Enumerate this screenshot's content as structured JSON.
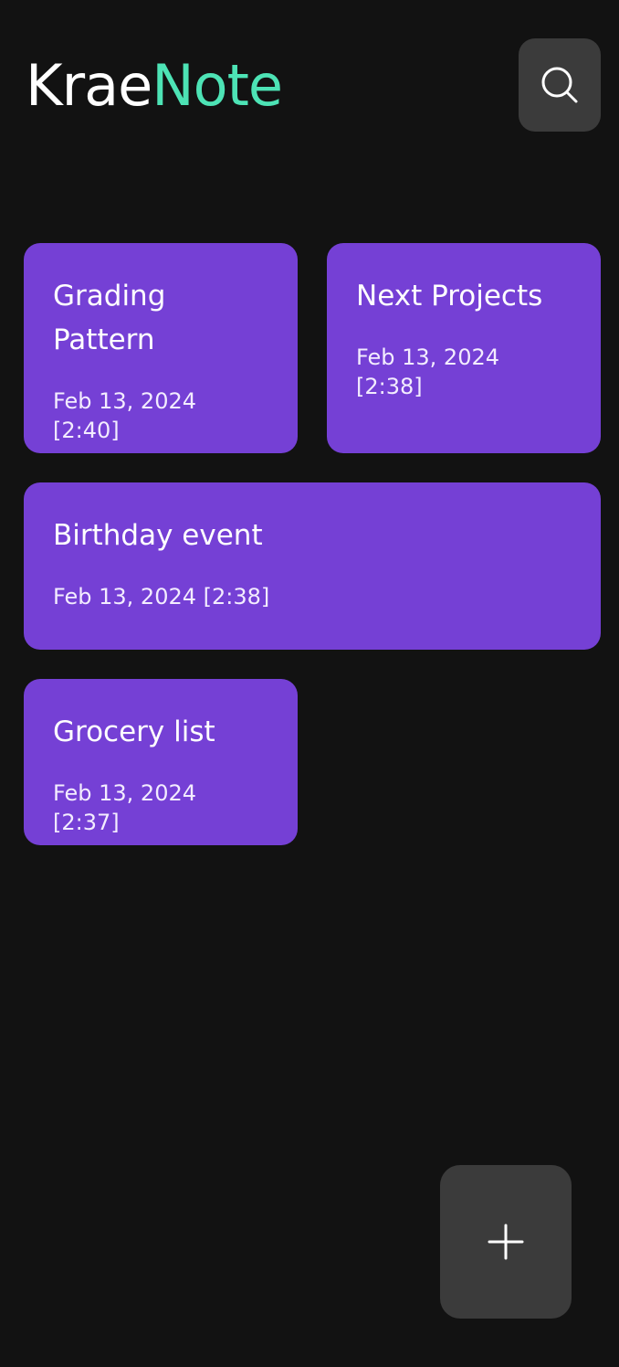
{
  "app": {
    "logo_part1": "Krae",
    "logo_part2": "Note",
    "search_icon": "search-icon",
    "add_icon": "plus-icon"
  },
  "colors": {
    "background": "#121212",
    "card": "#7540d5",
    "accent": "#4de3b5",
    "button": "#3b3b3b"
  },
  "notes": [
    {
      "title": "Grading Pattern",
      "date": "Feb 13, 2024 [2:40]"
    },
    {
      "title": "Next Projects",
      "date": "Feb 13, 2024 [2:38]"
    },
    {
      "title": "Birthday event",
      "date": "Feb 13, 2024 [2:38]"
    },
    {
      "title": "Grocery list",
      "date": "Feb 13, 2024 [2:37]"
    }
  ]
}
